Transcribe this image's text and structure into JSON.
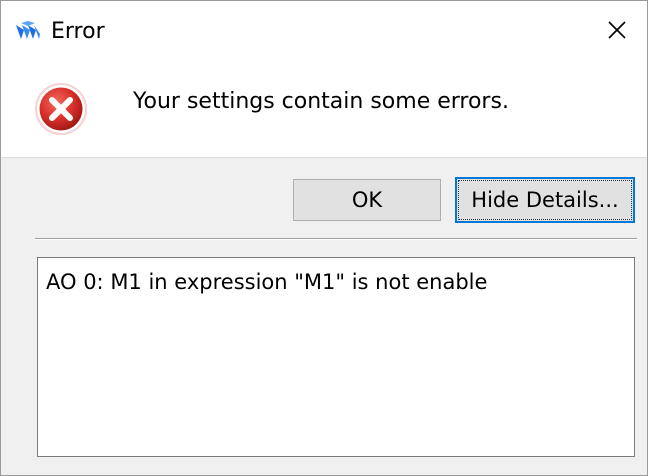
{
  "window": {
    "title": "Error",
    "logo_icon": "app-logo-icon",
    "close_icon": "close-icon"
  },
  "message": {
    "icon": "error-icon",
    "text": "Your settings contain some errors."
  },
  "buttons": {
    "ok_label": "OK",
    "details_label": "Hide Details..."
  },
  "details": {
    "text": "AO 0: M1 in expression \"M1\" is not enable"
  },
  "colors": {
    "error_red": "#d9302a",
    "focus_blue": "#0078d7",
    "logo_blue": "#2a6fd6"
  }
}
